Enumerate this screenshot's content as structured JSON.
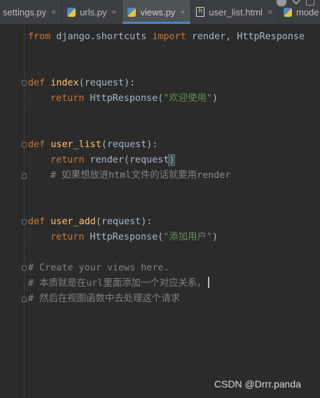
{
  "tabs": [
    {
      "label": "settings.py",
      "icon": "python-file-icon",
      "active": false
    },
    {
      "label": "urls.py",
      "icon": "python-file-icon",
      "active": false
    },
    {
      "label": "views.py",
      "icon": "python-file-icon",
      "active": true
    },
    {
      "label": "user_list.html",
      "icon": "html-file-icon",
      "active": false
    },
    {
      "label": "mode",
      "icon": "python-file-icon",
      "active": false
    }
  ],
  "close_glyph": "×",
  "code": {
    "line1": {
      "kw1": "from",
      "mod": " django.shortcuts ",
      "kw2": "import",
      "names": " render, HttpResponse"
    },
    "index": {
      "def": "def",
      "name": "index",
      "params": "(request):"
    },
    "index_return": {
      "kw": "return",
      "call": " HttpResponse(",
      "str": "\"欢迎使用\"",
      "close": ")"
    },
    "user_list": {
      "def": "def",
      "name": "user_list",
      "params": "(request):"
    },
    "user_list_return": {
      "kw": "return",
      "call": " render(request",
      "close": ")"
    },
    "user_list_comment": {
      "hash": "# 如果想放进",
      "mid": "html",
      "tail": "文件的话就要用",
      "end": "render"
    },
    "user_add": {
      "def": "def",
      "name": "user_add",
      "params": "(request):"
    },
    "user_add_return": {
      "kw": "return",
      "call": " HttpResponse(",
      "str": "\"添加用户\"",
      "close": ")"
    },
    "comment1": "# Create your views here.",
    "comment2": "# 本质就是在url里面添加一个对应关系，",
    "comment3": "# 然后在视图函数中去处理这个请求"
  },
  "watermark": "CSDN @Drrr.panda"
}
